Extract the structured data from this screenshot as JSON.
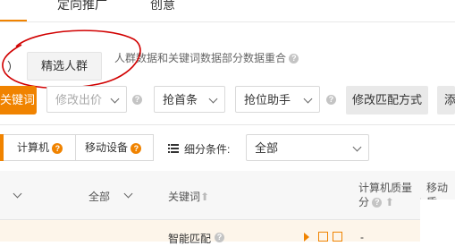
{
  "top_tabs": [
    {
      "label": "定向推广",
      "state": "default"
    },
    {
      "label": "创意",
      "state": "default"
    }
  ],
  "sub_tabs": {
    "partial_label": "）",
    "selected_label": "精选人群"
  },
  "hint": {
    "text": "人群数据和关键词数据部分数据重合"
  },
  "toolbar": {
    "add_keyword_partial": "关键词",
    "modify_bid_placeholder": "修改出价",
    "first_position_label": "抢首条",
    "position_assistant_label": "抢位助手",
    "modify_match_label": "修改匹配方式",
    "add_partial": "添"
  },
  "device_filter": {
    "computer_label": "计算机",
    "mobile_label": "移动设备",
    "segment_label": "细分条件:",
    "segment_value": "全部"
  },
  "table": {
    "headers": {
      "all_filter": "全部",
      "keyword": "关键词",
      "computer_quality_line1": "计算机质量",
      "computer_quality_line2": "分",
      "mobile_quality": "移动质"
    },
    "rows": [
      {
        "match_type": "智能匹配",
        "computer_quality": "-"
      }
    ]
  },
  "colors": {
    "accent": "#f08300",
    "annotation": "#d10000"
  },
  "icons": [
    "help-icon",
    "chevron-down-icon",
    "list-icon",
    "sort-arrow-icon",
    "play-icon",
    "chart-icon",
    "edit-icon"
  ]
}
